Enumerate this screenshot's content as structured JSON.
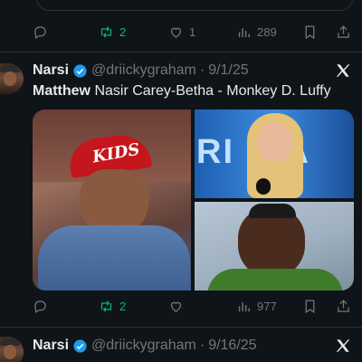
{
  "previous_tweet": {
    "actions": {
      "replies": "",
      "retweets": "2",
      "likes": "1",
      "views": "289"
    }
  },
  "tweet1": {
    "author": {
      "name": "Narsi",
      "handle": "@driickygraham",
      "separator": "·",
      "date": "9/1/25"
    },
    "text_bold": "Matthew",
    "text_rest": " Nasir Carey-Betha - Monkey D. Luffy",
    "media_captions": {
      "top_right_banner": "RI  CA"
    },
    "photo_left_cap_text": "KIDS",
    "actions": {
      "replies": "",
      "retweets": "2",
      "likes": "",
      "views": "977"
    }
  },
  "tweet2": {
    "author": {
      "name": "Narsi",
      "handle": "@driickygraham",
      "separator": "·",
      "date": "9/16/25"
    }
  },
  "colors": {
    "background": "#0f1419",
    "text": "#e7e9ea",
    "muted": "#71767b",
    "retweet_green": "#00ba7c",
    "verified_blue": "#1d9bf0",
    "divider": "#2f3336"
  }
}
